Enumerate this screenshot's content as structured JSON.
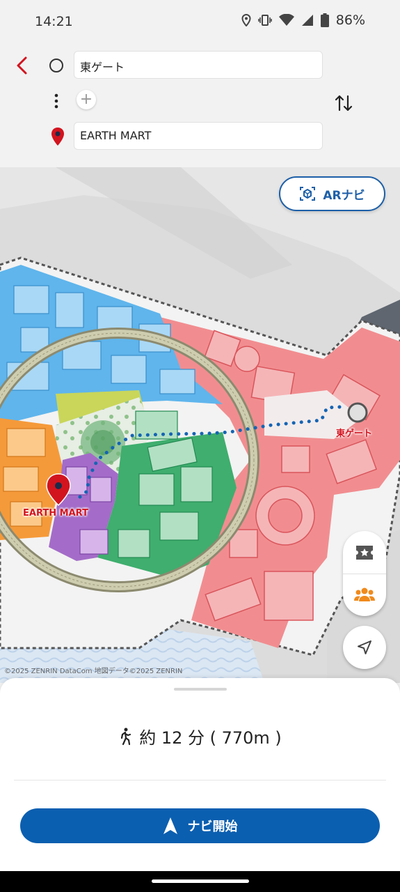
{
  "status": {
    "time": "14:21",
    "battery": "86%",
    "icons": [
      "location-icon",
      "vibrate-icon",
      "wifi-icon",
      "signal-icon",
      "battery-icon"
    ]
  },
  "header": {
    "origin_value": "東ゲート",
    "destination_value": "EARTH MART",
    "add_label": "+"
  },
  "map": {
    "ar_button_label": "ARナビ",
    "origin_label": "東ゲート",
    "destination_label": "EARTH MART",
    "copyright": "©2025 ZENRIN DataCom 地図データ©2025 ZENRIN"
  },
  "route": {
    "summary": "約 12 分 ( 770m )"
  },
  "actions": {
    "start_label": "ナビ開始"
  },
  "colors": {
    "accent_red": "#d2141f",
    "primary_blue": "#0b5fb0",
    "zone_blue": "#44a6e8",
    "zone_red": "#ef6b6f",
    "zone_green": "#3aaa6a",
    "zone_purple": "#a46cc8",
    "zone_orange": "#f59a3a",
    "zone_yellow": "#c8d84a"
  }
}
